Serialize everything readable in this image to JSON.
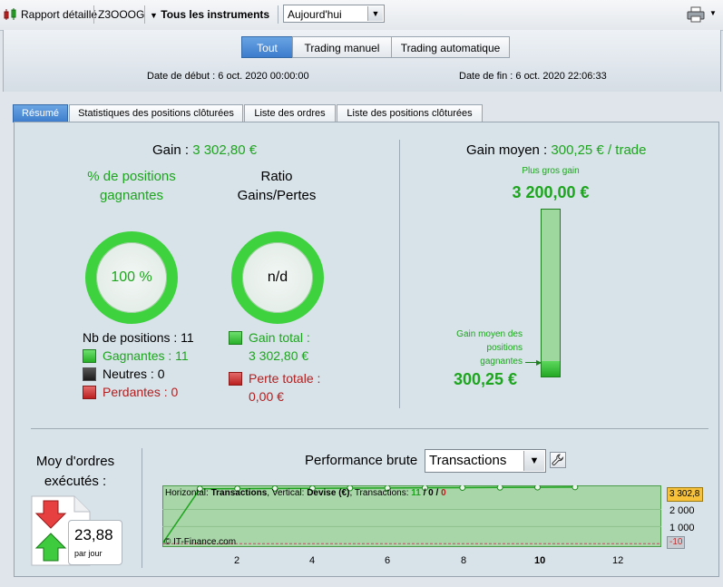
{
  "toolbar": {
    "report_label": "Rapport détaillé",
    "account": "Z3OOOG",
    "instruments": "Tous les instruments",
    "period": "Aujourd'hui"
  },
  "filters": [
    "Tout",
    "Trading manuel",
    "Trading automatique"
  ],
  "dates": {
    "start_label": "Date de début :",
    "start_value": "6 oct. 2020 00:00:00",
    "end_label": "Date de fin :",
    "end_value": "6 oct. 2020 22:06:33"
  },
  "tabs": [
    "Résumé",
    "Statistiques des positions clôturées",
    "Liste des ordres",
    "Liste des positions clôturées"
  ],
  "summary": {
    "gain_label": "Gain :",
    "gain_value": "3 302,80 €",
    "win_pct_label": "% de positions gagnantes",
    "win_pct_value": "100 %",
    "ratio_label": "Ratio Gains/Pertes",
    "ratio_value": "n/d",
    "nb_label": "Nb de positions : 11",
    "winning": "Gagnantes : 11",
    "neutral": "Neutres : 0",
    "losing": "Perdantes : 0",
    "gain_total_label": "Gain total :",
    "gain_total_value": "3 302,80 €",
    "loss_total_label": "Perte totale :",
    "loss_total_value": "0,00 €",
    "avg_gain_label": "Gain moyen :",
    "avg_gain_value": "300,25 € / trade",
    "max_gain_label": "Plus gros gain",
    "max_gain_value": "3 200,00 €",
    "avg_win_label": "Gain moyen des positions gagnantes",
    "avg_win_value": "300,25 €",
    "avg_orders_label": "Moy d'ordres exécutés :",
    "avg_orders_value": "23,88",
    "avg_orders_unit": "par jour",
    "perf_label": "Performance brute",
    "perf_select": "Transactions"
  },
  "chart_data": {
    "type": "line",
    "info_prefix": "Horizontal: ",
    "info_h": "Transactions",
    "info_mid": ", Vertical: ",
    "info_v": "Devise (€)",
    "info_tx": ", Transactions: ",
    "info_win": "11",
    "info_sep1": " / ",
    "info_neu": "0",
    "info_sep2": " / ",
    "info_loss": "0",
    "copyright": "© IT-Finance.com",
    "x_ticks": [
      "2",
      "4",
      "6",
      "8",
      "10",
      "12"
    ],
    "y_ticks": [
      "2 000",
      "1 000"
    ],
    "last_value_label": "3 302,8",
    "min_label": "-10",
    "x": [
      0,
      1,
      2,
      3,
      4,
      5,
      6,
      7,
      8,
      9,
      10,
      11
    ],
    "values": [
      0,
      3200,
      3210,
      3220,
      3230,
      3240,
      3250,
      3260,
      3270,
      3280,
      3290,
      3302.8
    ],
    "xlim": [
      0,
      13.3
    ],
    "ylim": [
      -200,
      3400
    ]
  },
  "colors": {
    "accent": "#3c7ccc",
    "gain": "#1ea51e",
    "loss": "#b41e1e",
    "chart_fill": "#a9d6a9"
  }
}
